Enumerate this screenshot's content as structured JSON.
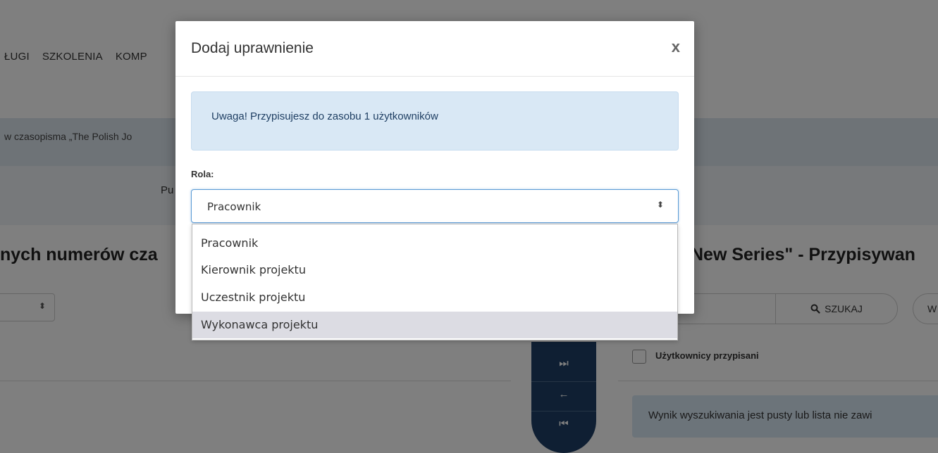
{
  "nav": {
    "items": [
      "ŁUGI",
      "SZKOLENIA",
      "KOMP"
    ]
  },
  "background": {
    "breadcrumb": "w czasopisma „The Polish Jo",
    "sub_link": "Pu",
    "left_title": "nych numerów cza",
    "right_title": "New Series\" - Przypisywan",
    "search_button": "SZUKAJ",
    "w_button": "W",
    "assigned_label": "Użytkownicy przypisani",
    "empty_message": "Wynik wyszukiwania jest pusty lub lista nie zawi"
  },
  "arrows": {
    "icons": [
      "double-right-icon",
      "left-arrow-icon",
      "double-left-icon"
    ]
  },
  "modal": {
    "title": "Dodaj uprawnienie",
    "close": "x",
    "alert": "Uwaga! Przypisujesz do zasobu 1 użytkowników",
    "role_label": "Rola:",
    "role_value": "Pracownik",
    "options": [
      "Pracownik",
      "Kierownik projektu",
      "Uczestnik projektu",
      "Wykonawca projektu"
    ]
  },
  "colors": {
    "navy": "#1e3f66",
    "alert_bg": "#d9e8f5",
    "focus_border": "#5b9bd5",
    "highlight": "#dcdce3"
  }
}
